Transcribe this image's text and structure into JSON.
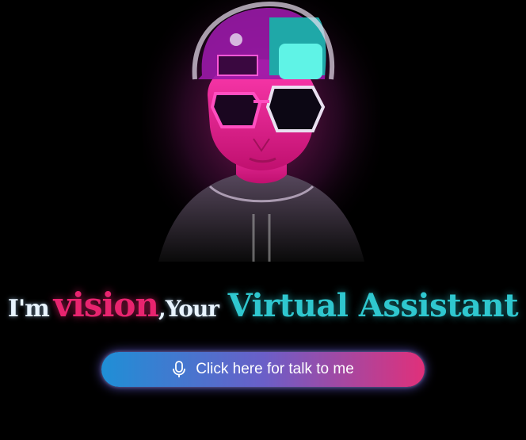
{
  "assistant": {
    "greeting_prefix": "I'm",
    "name": "vision",
    "greeting_middle": ",Your",
    "role": "Virtual Assistant"
  },
  "action": {
    "label": "Click here for talk to me",
    "icon": "microphone-icon"
  },
  "colors": {
    "background": "#000000",
    "name_accent": "#e8246f",
    "role_accent": "#2fc7cf",
    "button_gradient_start": "#1f8fd6",
    "button_gradient_end": "#e0307a"
  },
  "avatar": {
    "description_icon": "cyberpunk-avatar-image"
  }
}
